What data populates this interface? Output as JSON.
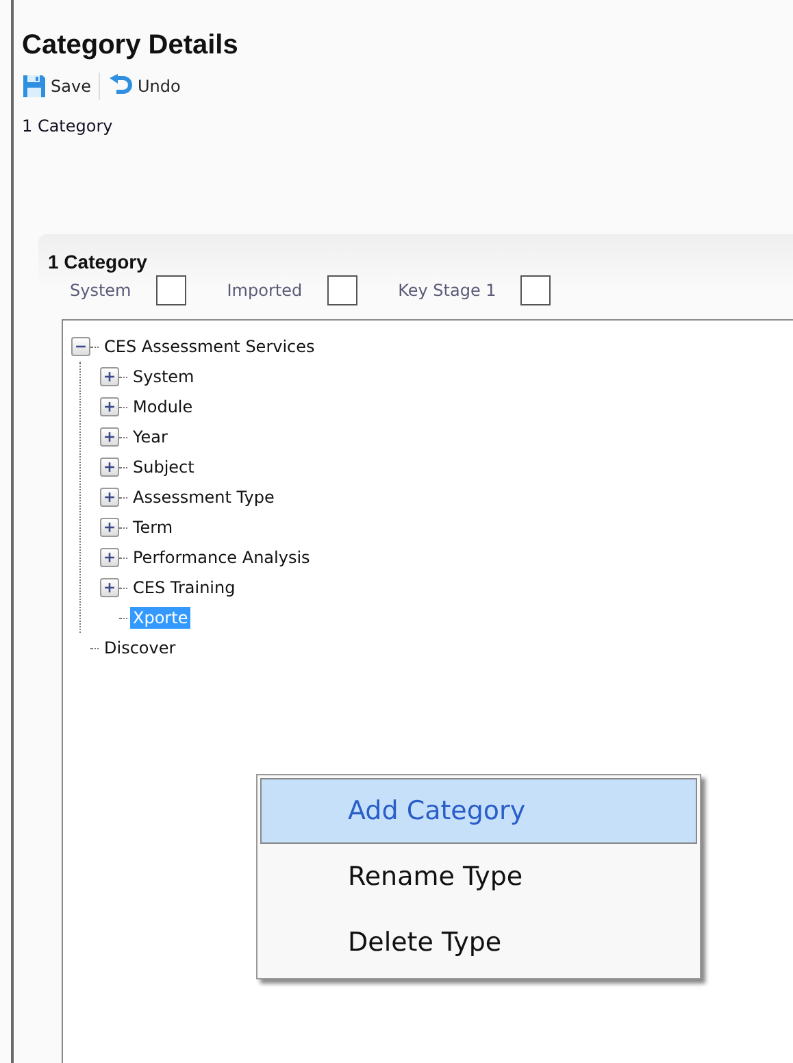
{
  "title": "Category Details",
  "toolbar": [
    {
      "label": "Save",
      "kind": "save"
    },
    {
      "label": "Undo",
      "kind": "undo"
    }
  ],
  "breadcrumb": "1 Category",
  "panel": {
    "title": "1 Category",
    "checkboxes": [
      {
        "label": "System",
        "checked": false
      },
      {
        "label": "Imported",
        "checked": false
      },
      {
        "label": "Key Stage 1",
        "checked": false
      }
    ],
    "tree": [
      {
        "label": "CES Assessment Services",
        "kind": "branch",
        "expanded": true,
        "selected": false,
        "children": [
          {
            "label": "System",
            "kind": "branch",
            "expanded": false,
            "selected": false
          },
          {
            "label": "Module",
            "kind": "branch",
            "expanded": false,
            "selected": false
          },
          {
            "label": "Year",
            "kind": "branch",
            "expanded": false,
            "selected": false
          },
          {
            "label": "Subject",
            "kind": "branch",
            "expanded": false,
            "selected": false
          },
          {
            "label": "Assessment Type",
            "kind": "branch",
            "expanded": false,
            "selected": false
          },
          {
            "label": "Term",
            "kind": "branch",
            "expanded": false,
            "selected": false
          },
          {
            "label": "Performance Analysis",
            "kind": "branch",
            "expanded": false,
            "selected": false
          },
          {
            "label": "CES Training",
            "kind": "branch",
            "expanded": false,
            "selected": false
          },
          {
            "label": "Xporte",
            "kind": "leaf",
            "selected": true
          }
        ]
      },
      {
        "label": "Discover",
        "kind": "leaf",
        "selected": false
      }
    ]
  },
  "context_menu": [
    {
      "label": "Add Category",
      "selected": true
    },
    {
      "label": "Rename Type",
      "selected": false
    },
    {
      "label": "Delete Type",
      "selected": false
    }
  ]
}
